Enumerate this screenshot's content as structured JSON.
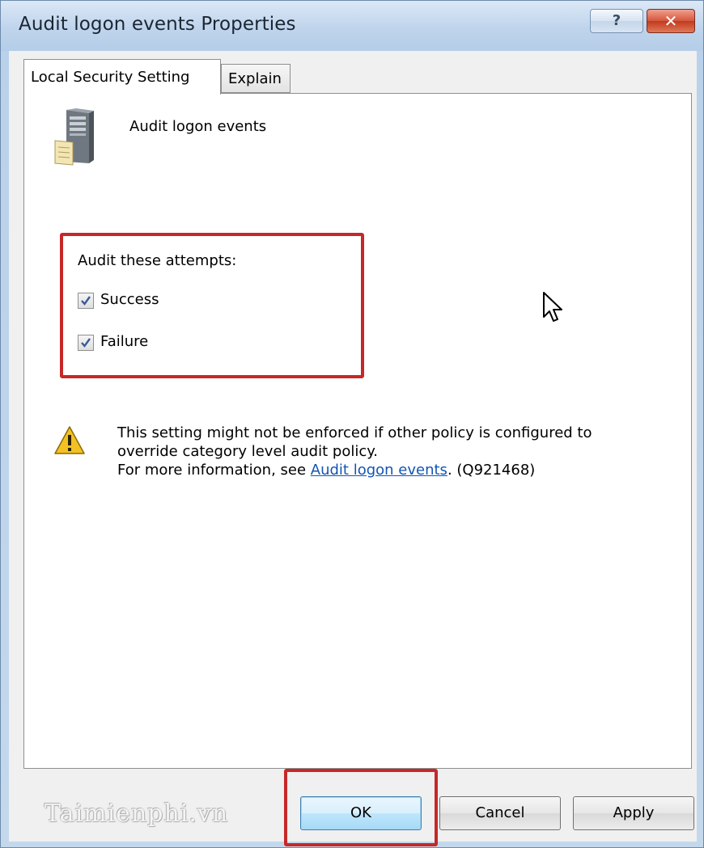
{
  "window": {
    "title": "Audit logon events Properties",
    "help_glyph": "?",
    "close_glyph": "✕"
  },
  "tabs": [
    {
      "label": "Local Security Setting",
      "active": true
    },
    {
      "label": "Explain",
      "active": false
    }
  ],
  "policy": {
    "name": "Audit logon events",
    "icon": "server-icon"
  },
  "audit": {
    "heading": "Audit these attempts:",
    "options": [
      {
        "label": "Success",
        "checked": true
      },
      {
        "label": "Failure",
        "checked": true
      }
    ]
  },
  "warning": {
    "icon": "warning-icon",
    "line1": "This setting might not be enforced if other policy is configured to",
    "line2": "override category level audit policy.",
    "line3_prefix": "For more information, see ",
    "link_text": "Audit logon events",
    "line3_suffix": ". (Q921468)"
  },
  "buttons": {
    "ok": "OK",
    "cancel": "Cancel",
    "apply": "Apply"
  },
  "watermark": "Taimienphi.vn",
  "colors": {
    "highlight": "#c62828",
    "link": "#1255b4",
    "close_button": "#c13a20"
  }
}
